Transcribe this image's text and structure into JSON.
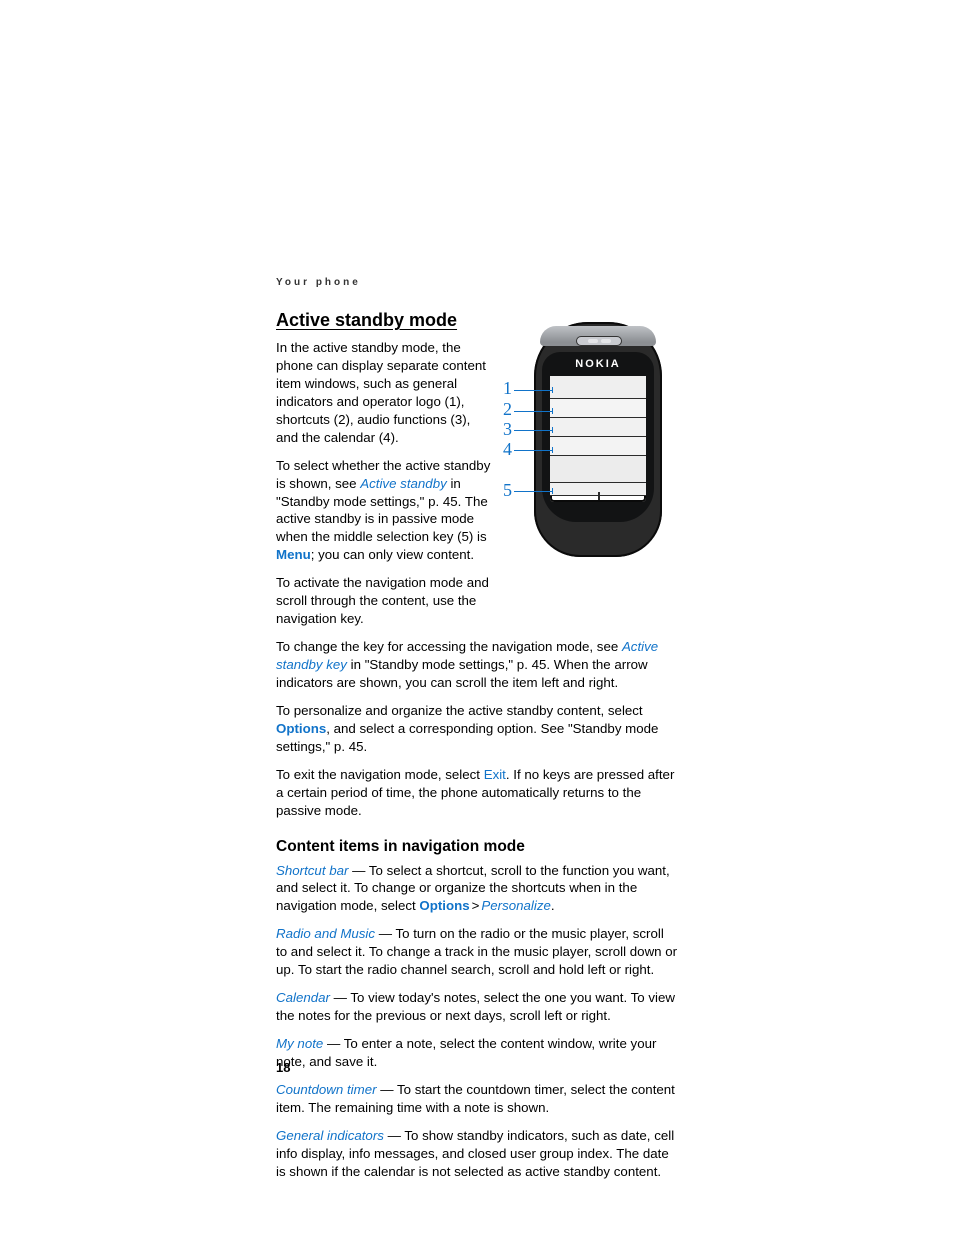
{
  "eyebrow": "Your phone",
  "h1": "Active standby mode",
  "p1": "In the active standby mode, the phone can display separate content item windows, such as general indicators and operator logo (1), shortcuts (2), audio functions (3), and the calendar (4).",
  "p2a": "To select whether the active standby is shown, see ",
  "p2_link1": "Active standby",
  "p2b": " in \"Standby mode settings,\" p. 45. The active standby is in passive mode when the middle selection key (5) is ",
  "p2_link2": "Menu",
  "p2c": "; you can only view content.",
  "p3": "To activate the navigation mode and scroll through the content, use the navigation key.",
  "p4a": "To change the key for accessing the navigation mode, see ",
  "p4_link1": "Active standby key",
  "p4b": " in \"Standby mode settings,\" p. 45. When the arrow indicators are shown, you can scroll the item left and right.",
  "p5a": "To personalize and organize the active standby content, select ",
  "p5_link1": "Options",
  "p5b": ", and select a corresponding option. See \"Standby mode settings,\" p. 45.",
  "p6a": "To exit the navigation mode, select ",
  "p6_link1": "Exit",
  "p6b": ". If no keys are pressed after a certain period of time, the phone automatically returns to the passive mode.",
  "h2": "Content items in navigation mode",
  "ci1_head": "Shortcut bar",
  "ci1a": " — To select a shortcut, scroll to the function you want, and select it. To change or organize the shortcuts when in the navigation mode, select ",
  "ci1_link1": "Options",
  "ci1_gt": ">",
  "ci1_link2": "Personalize",
  "ci1b": ".",
  "ci2_head": "Radio and Music",
  "ci2": " — To turn on the radio or the music player, scroll to and select it. To change a track in the music player, scroll down or up. To start the radio channel search, scroll and hold left or right.",
  "ci3_head": "Calendar",
  "ci3": " — To view today's notes, select the one you want. To view the notes for the previous or next days, scroll left or right.",
  "ci4_head": "My note",
  "ci4": " — To enter a note, select the content window, write your note, and save it.",
  "ci5_head": "Countdown timer",
  "ci5": " — To start the countdown timer, select the content item. The remaining time with a note is shown.",
  "ci6_head": "General indicators",
  "ci6": " — To show standby indicators, such as date, cell info display, info messages, and closed user group index. The date is shown if the calendar is not selected as active standby content.",
  "page_number": "18",
  "phone_brand": "NOKIA",
  "callouts": {
    "n1": "1",
    "n2": "2",
    "n3": "3",
    "n4": "4",
    "n5": "5"
  }
}
